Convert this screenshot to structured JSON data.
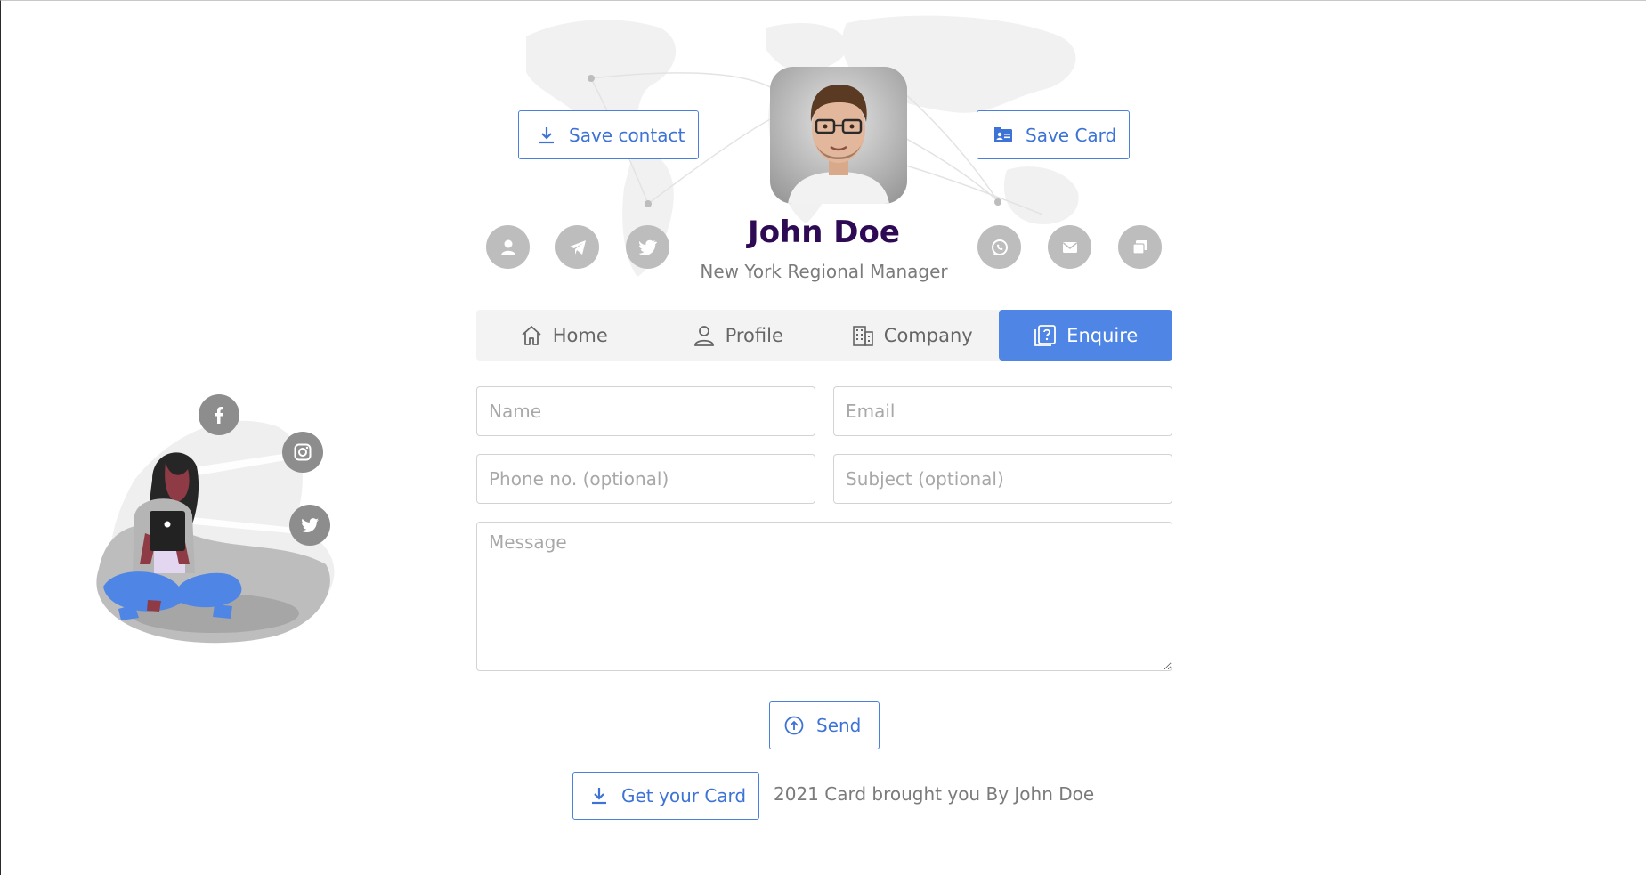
{
  "profile": {
    "name": "John Doe",
    "title": "New York Regional Manager"
  },
  "header_buttons": {
    "save_contact": "Save contact",
    "save_card": "Save Card"
  },
  "social_icons_left": [
    "contact-icon",
    "telegram-icon",
    "twitter-icon"
  ],
  "social_icons_right": [
    "whatsapp-icon",
    "mail-icon",
    "chat-icon"
  ],
  "tabs": [
    {
      "label": "Home",
      "icon": "home-icon",
      "active": false
    },
    {
      "label": "Profile",
      "icon": "person-icon",
      "active": false
    },
    {
      "label": "Company",
      "icon": "building-icon",
      "active": false
    },
    {
      "label": "Enquire",
      "icon": "enquire-icon",
      "active": true
    }
  ],
  "form": {
    "name_placeholder": "Name",
    "email_placeholder": "Email",
    "phone_placeholder": "Phone no. (optional)",
    "subject_placeholder": "Subject (optional)",
    "message_placeholder": "Message",
    "send_label": "Send"
  },
  "footer": {
    "get_card_label": "Get your Card",
    "text": "2021 Card brought you By John Doe"
  },
  "illustration_icons": [
    "facebook-icon",
    "instagram-icon",
    "twitter-icon"
  ],
  "colors": {
    "accent": "#4f86e6",
    "name": "#2e0a55",
    "muted_text": "#7b7b7b",
    "icon_circle": "#bdbdbd"
  }
}
